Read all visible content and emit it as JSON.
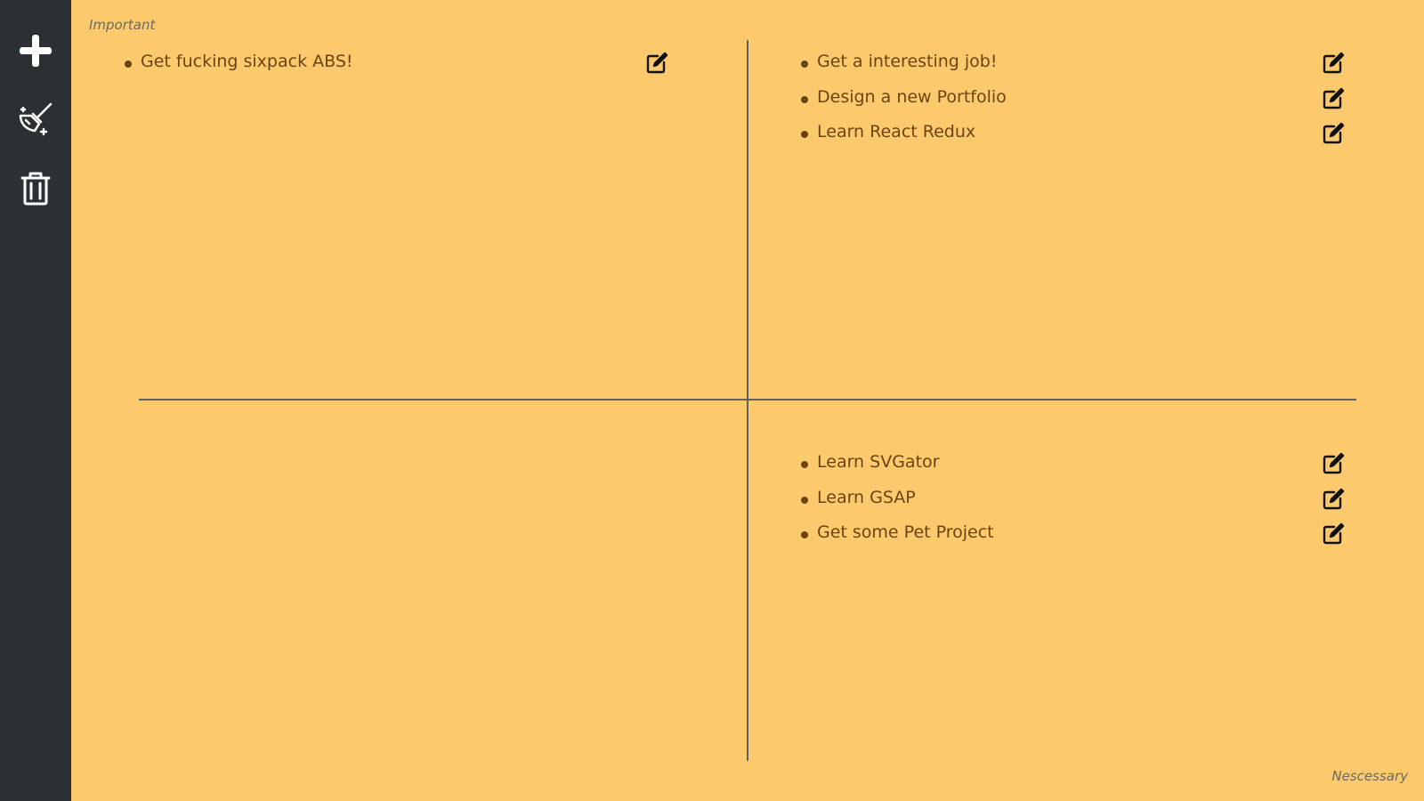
{
  "sidebar": {
    "add_icon": "plus-icon",
    "clean_icon": "broom-sparkle-icon",
    "delete_icon": "trash-icon"
  },
  "labels": {
    "top_left": "Important",
    "bottom_right": "Nescessary"
  },
  "quadrants": {
    "top_left": {
      "tasks": [
        "Get fucking sixpack ABS!"
      ]
    },
    "top_right": {
      "tasks": [
        "Get a interesting job!",
        "Design a new Portfolio",
        "Learn React Redux"
      ]
    },
    "bottom_left": {
      "tasks": []
    },
    "bottom_right": {
      "tasks": [
        "Learn SVGator",
        "Learn GSAP",
        "Get some Pet Project"
      ]
    }
  },
  "colors": {
    "background": "#fcc96d",
    "sidebar": "#2a3033",
    "task_text": "#6b4511",
    "axis": "#5c6262"
  }
}
